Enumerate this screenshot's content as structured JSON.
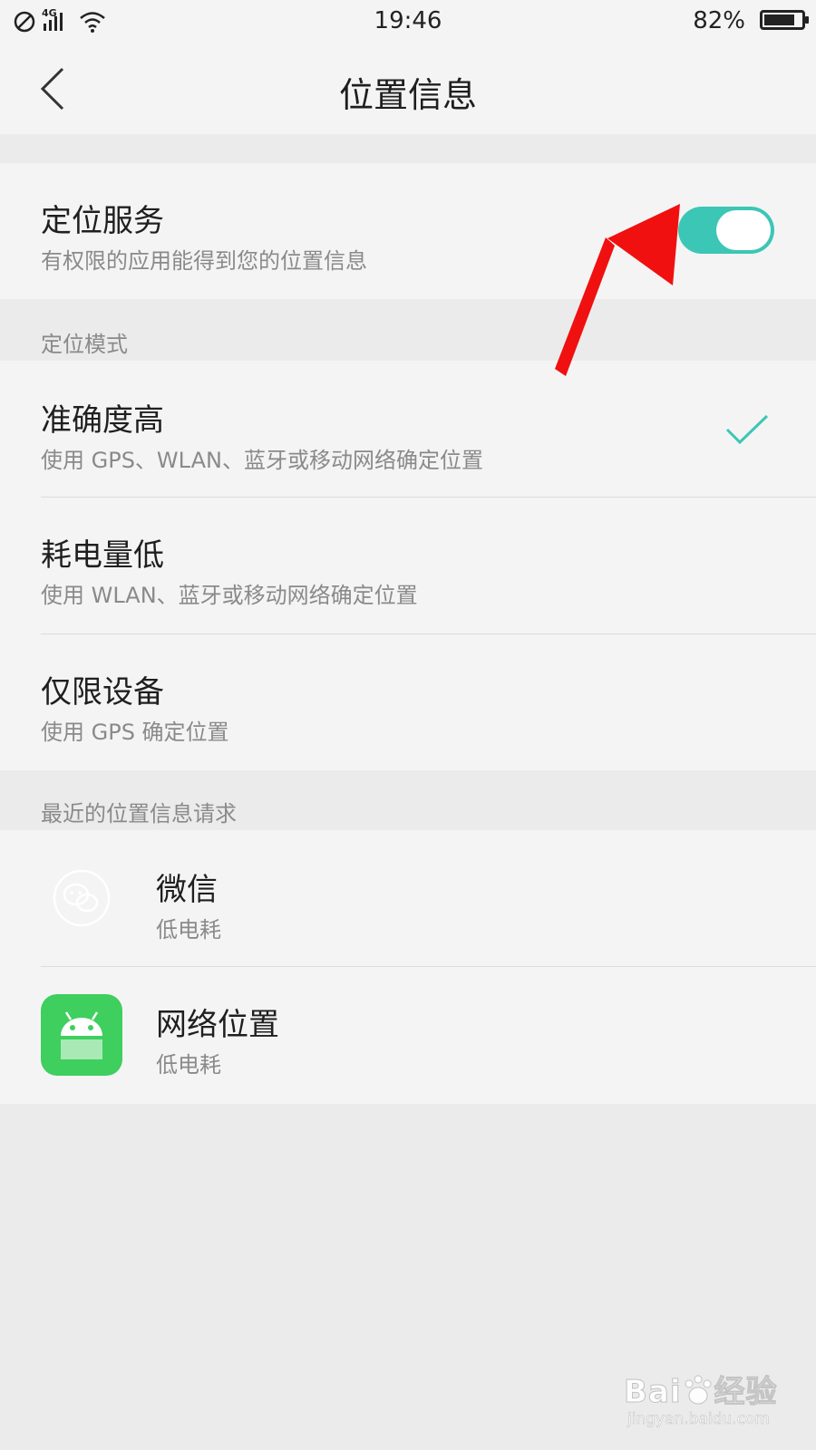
{
  "status_bar": {
    "network": "4G",
    "time": "19:46",
    "battery": "82%",
    "battery_level": 0.82,
    "icons": [
      "dnd-icon",
      "signal-icon",
      "wifi-icon",
      "battery-icon"
    ]
  },
  "header": {
    "title": "位置信息",
    "back_icon": "chevron-left-icon"
  },
  "location_service": {
    "title": "定位服务",
    "subtitle": "有权限的应用能得到您的位置信息",
    "enabled": true,
    "accent_color": "#3cc6b5"
  },
  "mode_section": {
    "label": "定位模式",
    "options": [
      {
        "title": "准确度高",
        "subtitle": "使用 GPS、WLAN、蓝牙或移动网络确定位置",
        "selected": true
      },
      {
        "title": "耗电量低",
        "subtitle": "使用 WLAN、蓝牙或移动网络确定位置",
        "selected": false
      },
      {
        "title": "仅限设备",
        "subtitle": "使用 GPS 确定位置",
        "selected": false
      }
    ]
  },
  "recent_section": {
    "label": "最近的位置信息请求",
    "apps": [
      {
        "name": "微信",
        "detail": "低电耗",
        "icon": "wechat-icon"
      },
      {
        "name": "网络位置",
        "detail": "低电耗",
        "icon": "android-icon",
        "icon_color": "#3ecf5e"
      }
    ]
  },
  "annotation": {
    "arrow_color": "#f01010",
    "arrow_icon": "red-arrow-icon"
  },
  "watermark": {
    "brand": "Bai",
    "brand_suffix": "经验",
    "url": "jingyan.baidu.com"
  }
}
